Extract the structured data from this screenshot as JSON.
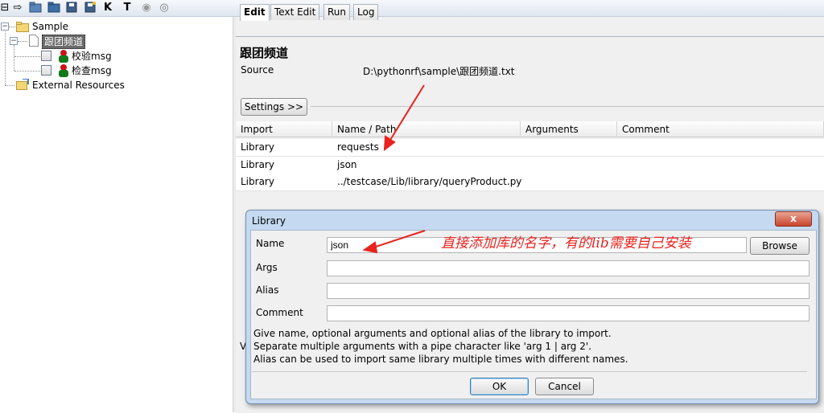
{
  "toolbar": {
    "icons": [
      "collapse-icon",
      "arrow-right-icon",
      "open-suite-icon",
      "open-folder-icon",
      "save-icon",
      "save-all-icon",
      "keyword-search-icon",
      "test-search-icon",
      "play-icon",
      "stop-icon"
    ],
    "k_label": "K",
    "t_label": "T"
  },
  "tree": {
    "root": "Sample",
    "suite": "跟团频道",
    "tests": [
      "校验msg",
      "检查msg"
    ],
    "external": "External Resources"
  },
  "tabs": [
    "Edit",
    "Text Edit",
    "Run",
    "Log"
  ],
  "editor": {
    "title": "跟团频道",
    "source_label": "Source",
    "source_value": "D:\\pythonrf\\sample\\跟团频道.txt",
    "settings_button": "Settings >>"
  },
  "imports_table": {
    "headers": [
      "Import",
      "Name / Path",
      "Arguments",
      "Comment"
    ],
    "rows": [
      {
        "type": "Library",
        "name": "requests",
        "args": "",
        "comment": ""
      },
      {
        "type": "Library",
        "name": "json",
        "args": "",
        "comment": ""
      },
      {
        "type": "Library",
        "name": "../testcase/Lib/library/queryProduct.py",
        "args": "",
        "comment": ""
      }
    ]
  },
  "hidden_partial": "V",
  "dialog": {
    "title": "Library",
    "close_label": "x",
    "name_label": "Name",
    "name_value": "json",
    "browse_button": "Browse",
    "args_label": "Args",
    "alias_label": "Alias",
    "comment_label": "Comment",
    "help_lines": [
      "Give name, optional arguments and optional alias of the library to import.",
      "Separate multiple arguments with a pipe character like 'arg 1 | arg 2'.",
      "Alias can be used to import same library multiple times with different names."
    ],
    "ok_button": "OK",
    "cancel_button": "Cancel"
  },
  "annotation": "直接添加库的名字，有的lib需要自己安装",
  "colors": {
    "annotation_red": "#e8231f",
    "dialog_frame": "#c5daf0",
    "close_red": "#c8452c"
  }
}
